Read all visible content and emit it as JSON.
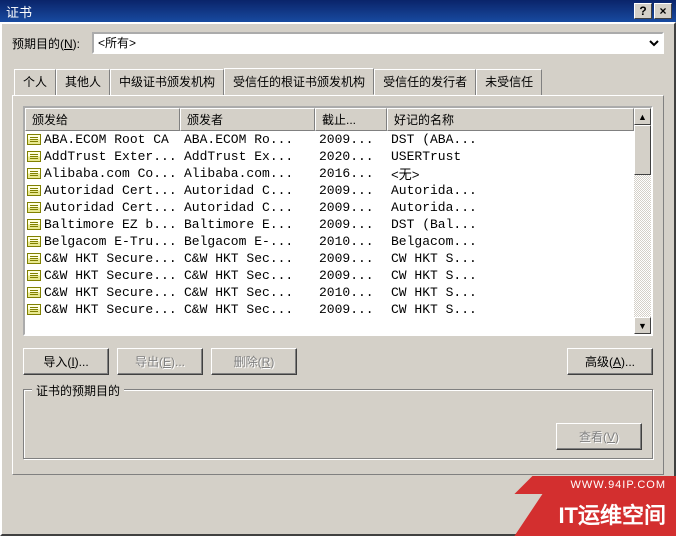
{
  "window": {
    "title": "证书"
  },
  "purpose": {
    "label_pre": "预期目的(",
    "label_key": "N",
    "label_post": "):",
    "options": [
      "<所有>"
    ],
    "selected": "<所有>"
  },
  "tabs": [
    {
      "id": "personal",
      "label": "个人"
    },
    {
      "id": "others",
      "label": "其他人"
    },
    {
      "id": "intermediate",
      "label": "中级证书颁发机构"
    },
    {
      "id": "trusted-root",
      "label": "受信任的根证书颁发机构"
    },
    {
      "id": "trusted-publishers",
      "label": "受信任的发行者"
    },
    {
      "id": "untrusted",
      "label": "未受信任"
    }
  ],
  "active_tab": 3,
  "listview": {
    "headers": [
      "颁发给",
      "颁发者",
      "截止...",
      "好记的名称"
    ],
    "rows": [
      {
        "c1": "ABA.ECOM Root CA",
        "c2": "ABA.ECOM Ro...",
        "c3": "2009...",
        "c4": "DST (ABA..."
      },
      {
        "c1": "AddTrust Exter...",
        "c2": "AddTrust Ex...",
        "c3": "2020...",
        "c4": "USERTrust"
      },
      {
        "c1": "Alibaba.com Co...",
        "c2": "Alibaba.com...",
        "c3": "2016...",
        "c4": "<无>"
      },
      {
        "c1": "Autoridad Cert...",
        "c2": "Autoridad C...",
        "c3": "2009...",
        "c4": "Autorida..."
      },
      {
        "c1": "Autoridad Cert...",
        "c2": "Autoridad C...",
        "c3": "2009...",
        "c4": "Autorida..."
      },
      {
        "c1": "Baltimore EZ b...",
        "c2": "Baltimore E...",
        "c3": "2009...",
        "c4": "DST (Bal..."
      },
      {
        "c1": "Belgacom E-Tru...",
        "c2": "Belgacom E-...",
        "c3": "2010...",
        "c4": "Belgacom..."
      },
      {
        "c1": "C&W HKT Secure...",
        "c2": "C&W HKT Sec...",
        "c3": "2009...",
        "c4": "CW HKT S..."
      },
      {
        "c1": "C&W HKT Secure...",
        "c2": "C&W HKT Sec...",
        "c3": "2009...",
        "c4": "CW HKT S..."
      },
      {
        "c1": "C&W HKT Secure...",
        "c2": "C&W HKT Sec...",
        "c3": "2010...",
        "c4": "CW HKT S..."
      },
      {
        "c1": "C&W HKT Secure...",
        "c2": "C&W HKT Sec...",
        "c3": "2009...",
        "c4": "CW HKT S..."
      }
    ]
  },
  "buttons": {
    "import_pre": "导入(",
    "import_key": "I",
    "import_post": ")...",
    "export_pre": "导出(",
    "export_key": "E",
    "export_post": ")...",
    "delete_pre": "删除(",
    "delete_key": "R",
    "delete_post": ")",
    "advanced_pre": "高级(",
    "advanced_key": "A",
    "advanced_post": ")...",
    "view_pre": "查看(",
    "view_key": "V",
    "view_post": ")"
  },
  "group": {
    "legend": "证书的预期目的"
  },
  "watermark": {
    "url": "WWW.94IP.COM",
    "brand": "IT运维空间"
  }
}
